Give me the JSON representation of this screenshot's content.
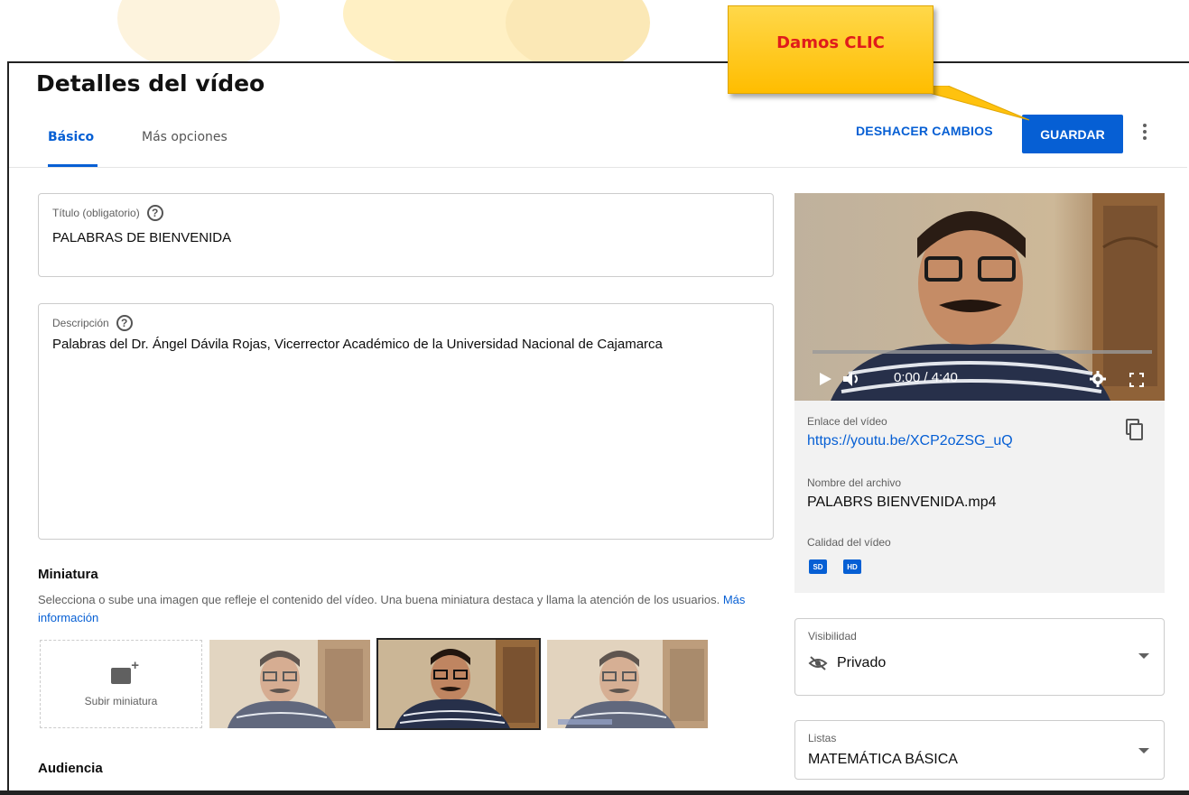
{
  "header": {
    "page_title": "Detalles del vídeo",
    "tabs": [
      {
        "label": "Básico"
      },
      {
        "label": "Más opciones"
      }
    ],
    "undo_label": "DESHACER CAMBIOS",
    "save_label": "GUARDAR"
  },
  "callout": {
    "text": "Damos CLIC"
  },
  "form": {
    "title": {
      "label": "Título (obligatorio)",
      "value": "PALABRAS DE BIENVENIDA"
    },
    "description": {
      "label": "Descripción",
      "value": "Palabras del Dr. Ángel Dávila Rojas, Vicerrector Académico de la Universidad Nacional de Cajamarca"
    },
    "help_glyph": "?"
  },
  "thumbnail": {
    "title": "Miniatura",
    "description": "Selecciona o sube una imagen que refleje el contenido del vídeo. Una buena miniatura destaca y llama la atención de los usuarios.",
    "link": "Más información",
    "upload_label": "Subir miniatura"
  },
  "audience": {
    "title": "Audiencia"
  },
  "video": {
    "time": "0:00 / 4:40",
    "progress": 0,
    "link_label": "Enlace del vídeo",
    "link": "https://youtu.be/XCP2oZSG_uQ",
    "filename_label": "Nombre del archivo",
    "filename": "PALABRS BIENVENIDA.mp4",
    "quality_label": "Calidad del vídeo",
    "quality_badges": [
      "SD",
      "HD"
    ]
  },
  "visibility": {
    "label": "Visibilidad",
    "value": "Privado"
  },
  "playlists": {
    "label": "Listas",
    "value": "MATEMÁTICA BÁSICA"
  },
  "colors": {
    "accent": "#065fd4",
    "callout_bg": "#ffc20e",
    "callout_text": "#e01b1b"
  }
}
